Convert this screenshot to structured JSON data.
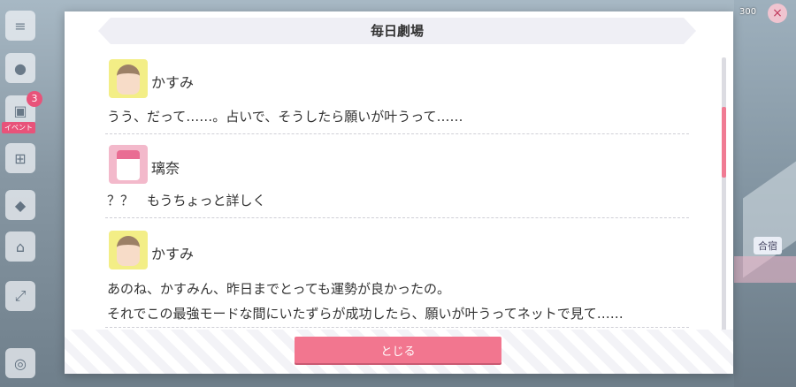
{
  "dialog": {
    "title": "毎日劇場",
    "close_label": "とじる"
  },
  "entries": [
    {
      "speaker": "かすみ",
      "avatar": "kasumi-avatar",
      "lines": [
        "うう、だって……。占いで、そうしたら願いが叶うって……"
      ]
    },
    {
      "speaker": "璃奈",
      "avatar": "rina-avatar",
      "lines": [
        "？？　もうちょっと詳しく"
      ]
    },
    {
      "speaker": "かすみ",
      "avatar": "kasumi-avatar",
      "lines": [
        "あのね、かすみん、昨日までとっても運勢が良かったの。",
        "それでこの最強モードな間にいたずらが成功したら、願いが叶うってネットで見て……"
      ]
    }
  ],
  "background": {
    "left_badge_count": "3",
    "left_tag": "イベント",
    "right_label": "合宿",
    "coin_text": "300"
  },
  "colors": {
    "accent": "#f2768f",
    "kasumi_bg": "#f3ee86",
    "rina_bg": "#f3b9cb"
  }
}
